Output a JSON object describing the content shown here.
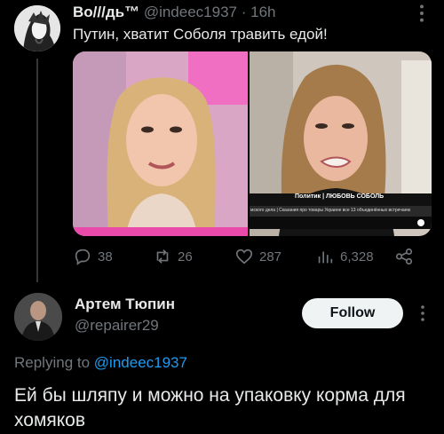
{
  "tweet": {
    "author_name": "Во///дь™",
    "handle": "@indeec1937",
    "separator": "·",
    "time": "16h",
    "text": "Путин, хватит Соболя травить едой!",
    "media": {
      "chyron_title": "Политик | ЛЮБОВЬ СОБОЛЬ",
      "chyron_sub": "мского дела | Сказания про товары Украине все 13 объединённых встречаем"
    },
    "actions": {
      "replies": "38",
      "retweets": "26",
      "likes": "287",
      "views": "6,328"
    }
  },
  "reply": {
    "author_name": "Артем Тюпин",
    "handle": "@repairer29",
    "follow_label": "Follow",
    "replying_prefix": "Replying to",
    "replying_to": "@indeec1937",
    "text": "Ей бы шляпу и можно на упаковку корма для хомяков"
  },
  "colors": {
    "background": "#000000",
    "text": "#e7e9ea",
    "muted": "#71767b",
    "link": "#1d9bf0",
    "follow_bg": "#eff3f4",
    "thread_line": "#333639"
  }
}
